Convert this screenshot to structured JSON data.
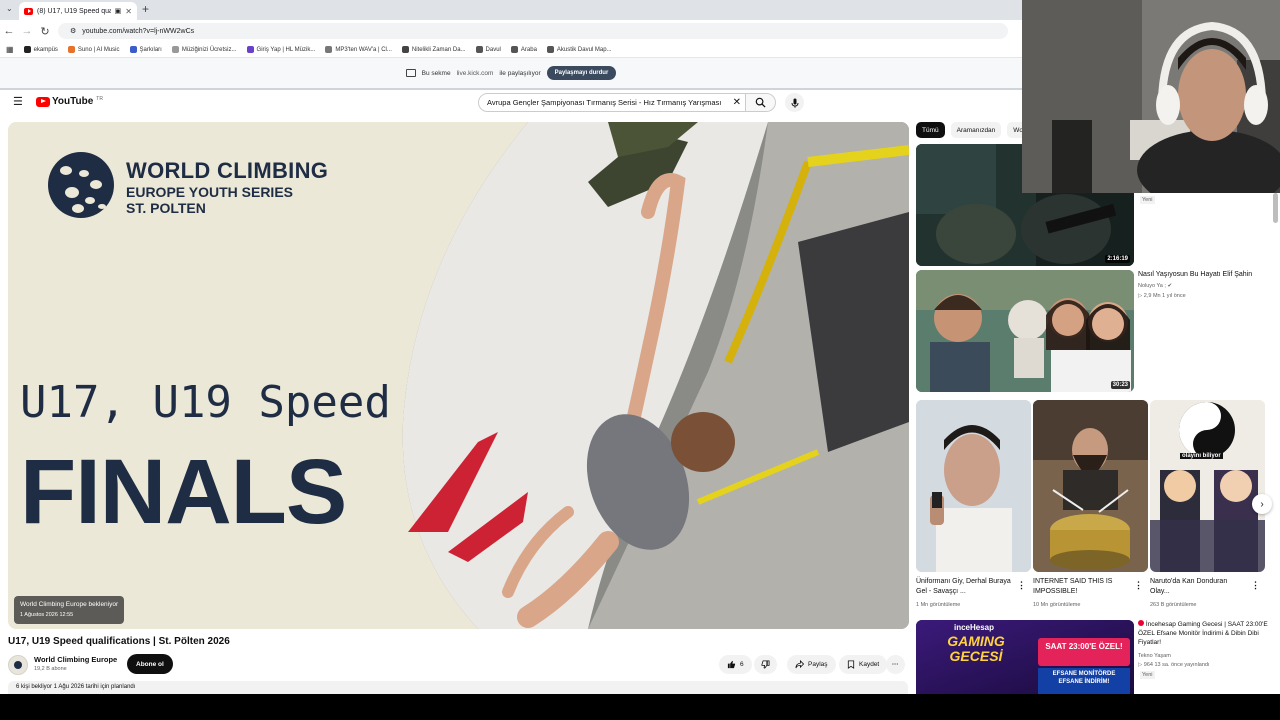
{
  "browser": {
    "tab_title": "(8) U17, U19 Speed qualifica",
    "url": "youtube.com/watch?v=lj-nWW2wCs",
    "bookmarks": [
      {
        "label": "ekampüs",
        "color": "#222"
      },
      {
        "label": "Suno | AI Music",
        "color": "#e8712c"
      },
      {
        "label": "Şarkıları",
        "color": "#3b5ccc"
      },
      {
        "label": "Müziğinizi Ücretsiz...",
        "color": "#999"
      },
      {
        "label": "Giriş Yap | HL Müzik...",
        "color": "#6a3fc9"
      },
      {
        "label": "MP3'ten WAV'a | Cl...",
        "color": "#777"
      },
      {
        "label": "Nitelikli Zaman Da...",
        "color": "#444"
      },
      {
        "label": "Davul",
        "color": "#555"
      },
      {
        "label": "Araba",
        "color": "#555"
      },
      {
        "label": "Akustik Davul Map...",
        "color": "#555"
      }
    ],
    "share": {
      "prefix": "Bu sekme",
      "site": "live.kick.com",
      "suffix": "ile paylaşılıyor",
      "stop_button": "Paylaşmayı durdur"
    }
  },
  "youtube": {
    "logo_text": "YouTube",
    "logo_region": "TR",
    "search_query": "Avrupa Gençler Şampiyonası Tırmanış Serisi - Hız Tırmanış Yarışması",
    "player": {
      "brand_l1": "WORLD CLIMBING",
      "brand_l2": "EUROPE YOUTH SERIES",
      "brand_l3": "ST. POLTEN",
      "headline": "U17, U19 Speed",
      "finals": "FINALS",
      "waiting_title": "World Climbing Europe bekleniyor",
      "waiting_date": "1 Ağustos 2026 12:55"
    },
    "video_title": "U17, U19 Speed qualifications | St. Pölten 2026",
    "channel_name": "World Climbing Europe",
    "channel_subs": "19,2 B abone",
    "subscribe": "Abone ol",
    "likes": "6",
    "share": "Paylaş",
    "save": "Kaydet",
    "desc_line": "6 kişi bekliyor  1 Ağu 2026 tarihi için planlandı"
  },
  "sidebar": {
    "chips": [
      "Tümü",
      "Aramanızdan",
      "Wo"
    ],
    "items": [
      {
        "duration": "2:16:19",
        "badge": "Yeni"
      },
      {
        "duration": "30:23",
        "title": "Nasıl Yaşıyosun Bu Hayatı Elif Şahin",
        "channel": "Noluyo Ya ;",
        "stats": "2,9 Mn  1 yıl önce"
      }
    ],
    "shorts": [
      {
        "title": "Üniformanı Giy, Derhal Buraya Gel - Savaşçı ...",
        "views": "1 Mn görüntüleme"
      },
      {
        "title": "INTERNET SAID THIS IS IMPOSSIBLE!",
        "views": "10 Mn görüntüleme"
      },
      {
        "title": "Naruto'da Kan Donduran Olay...",
        "views": "263 B görüntüleme",
        "overlay": "olayını biliyor"
      }
    ],
    "ad": {
      "title": "İncehesap Gaming Gecesi | SAAT 23:00'E ÖZEL Efsane Monitör İndirimi & Dibin Dibi Fiyatlar!",
      "channel": "Tekno Yaşam",
      "stats": "964  13 sa. önce yayınlandı",
      "badge": "Yeni",
      "banner_brand": "inceHesap",
      "banner_big": "GAMING GECESİ",
      "banner_time": "SAAT 23:00'E ÖZEL!",
      "banner_promo": "EFSANE MONİTÖRDE EFSANE İNDİRİM!"
    }
  },
  "colors": {
    "brand_navy": "#1f2d44",
    "yt_red": "#ff0000",
    "share_btn": "#3b4a5e"
  }
}
